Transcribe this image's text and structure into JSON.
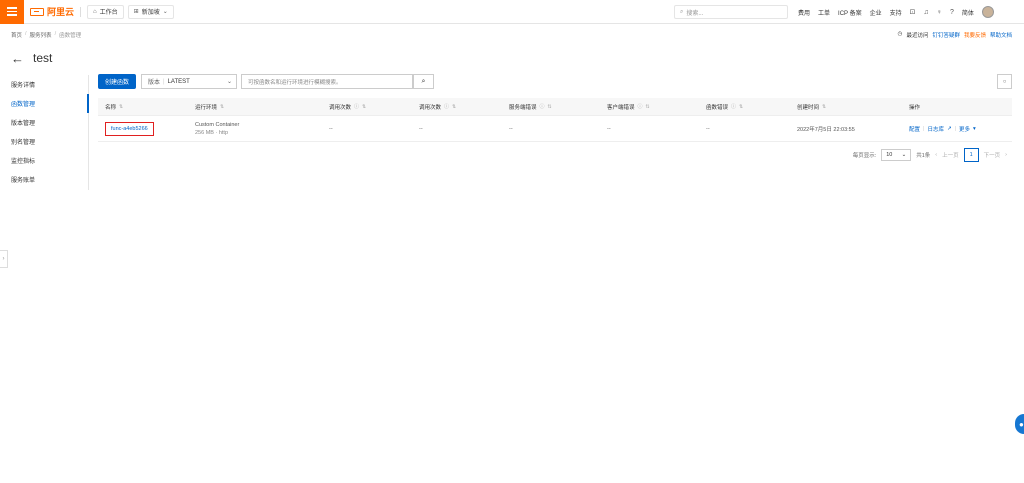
{
  "topbar": {
    "brand": "阿里云",
    "workbench": "工作台",
    "region": "新加坡",
    "search_placeholder": "搜索...",
    "links": [
      "费用",
      "工单",
      "ICP 备案",
      "企业",
      "支持"
    ],
    "lang": "简体"
  },
  "breadcrumb": [
    "首页",
    "服务列表",
    "函数管理"
  ],
  "header_links": {
    "recent": "最近访问",
    "dingtalk": "钉钉答疑群",
    "feedback": "我要反馈",
    "docs": "帮助文档"
  },
  "page": {
    "title": "test"
  },
  "sidebar": {
    "items": [
      "服务详情",
      "函数管理",
      "版本管理",
      "别名管理",
      "监控指标",
      "服务账单"
    ],
    "active_index": 1
  },
  "toolbar": {
    "create_label": "创建函数",
    "version_key": "版本",
    "version_value": "LATEST",
    "filter_placeholder": "可按函数名和运行环境进行模糊搜索。"
  },
  "table": {
    "headers": [
      "名称",
      "运行环境",
      "调用次数",
      "调用次数",
      "服务端错误",
      "客户端错误",
      "函数错误",
      "创建时间",
      "操作"
    ],
    "rows": [
      {
        "name": "func-a4eb5266",
        "env_line1": "Custom Container",
        "env_line2": "256 MB · http",
        "invocations": "--",
        "calls": "--",
        "server_errors": "--",
        "client_errors": "--",
        "function_errors": "--",
        "created": "2022年7月5日 22:03:55",
        "op_config": "配置",
        "op_logs": "日志库",
        "op_more": "更多"
      }
    ]
  },
  "pager": {
    "per_page_label": "每页显示:",
    "per_page": "10",
    "total": "共1条",
    "prev": "上一页",
    "current": "1",
    "next": "下一页"
  }
}
